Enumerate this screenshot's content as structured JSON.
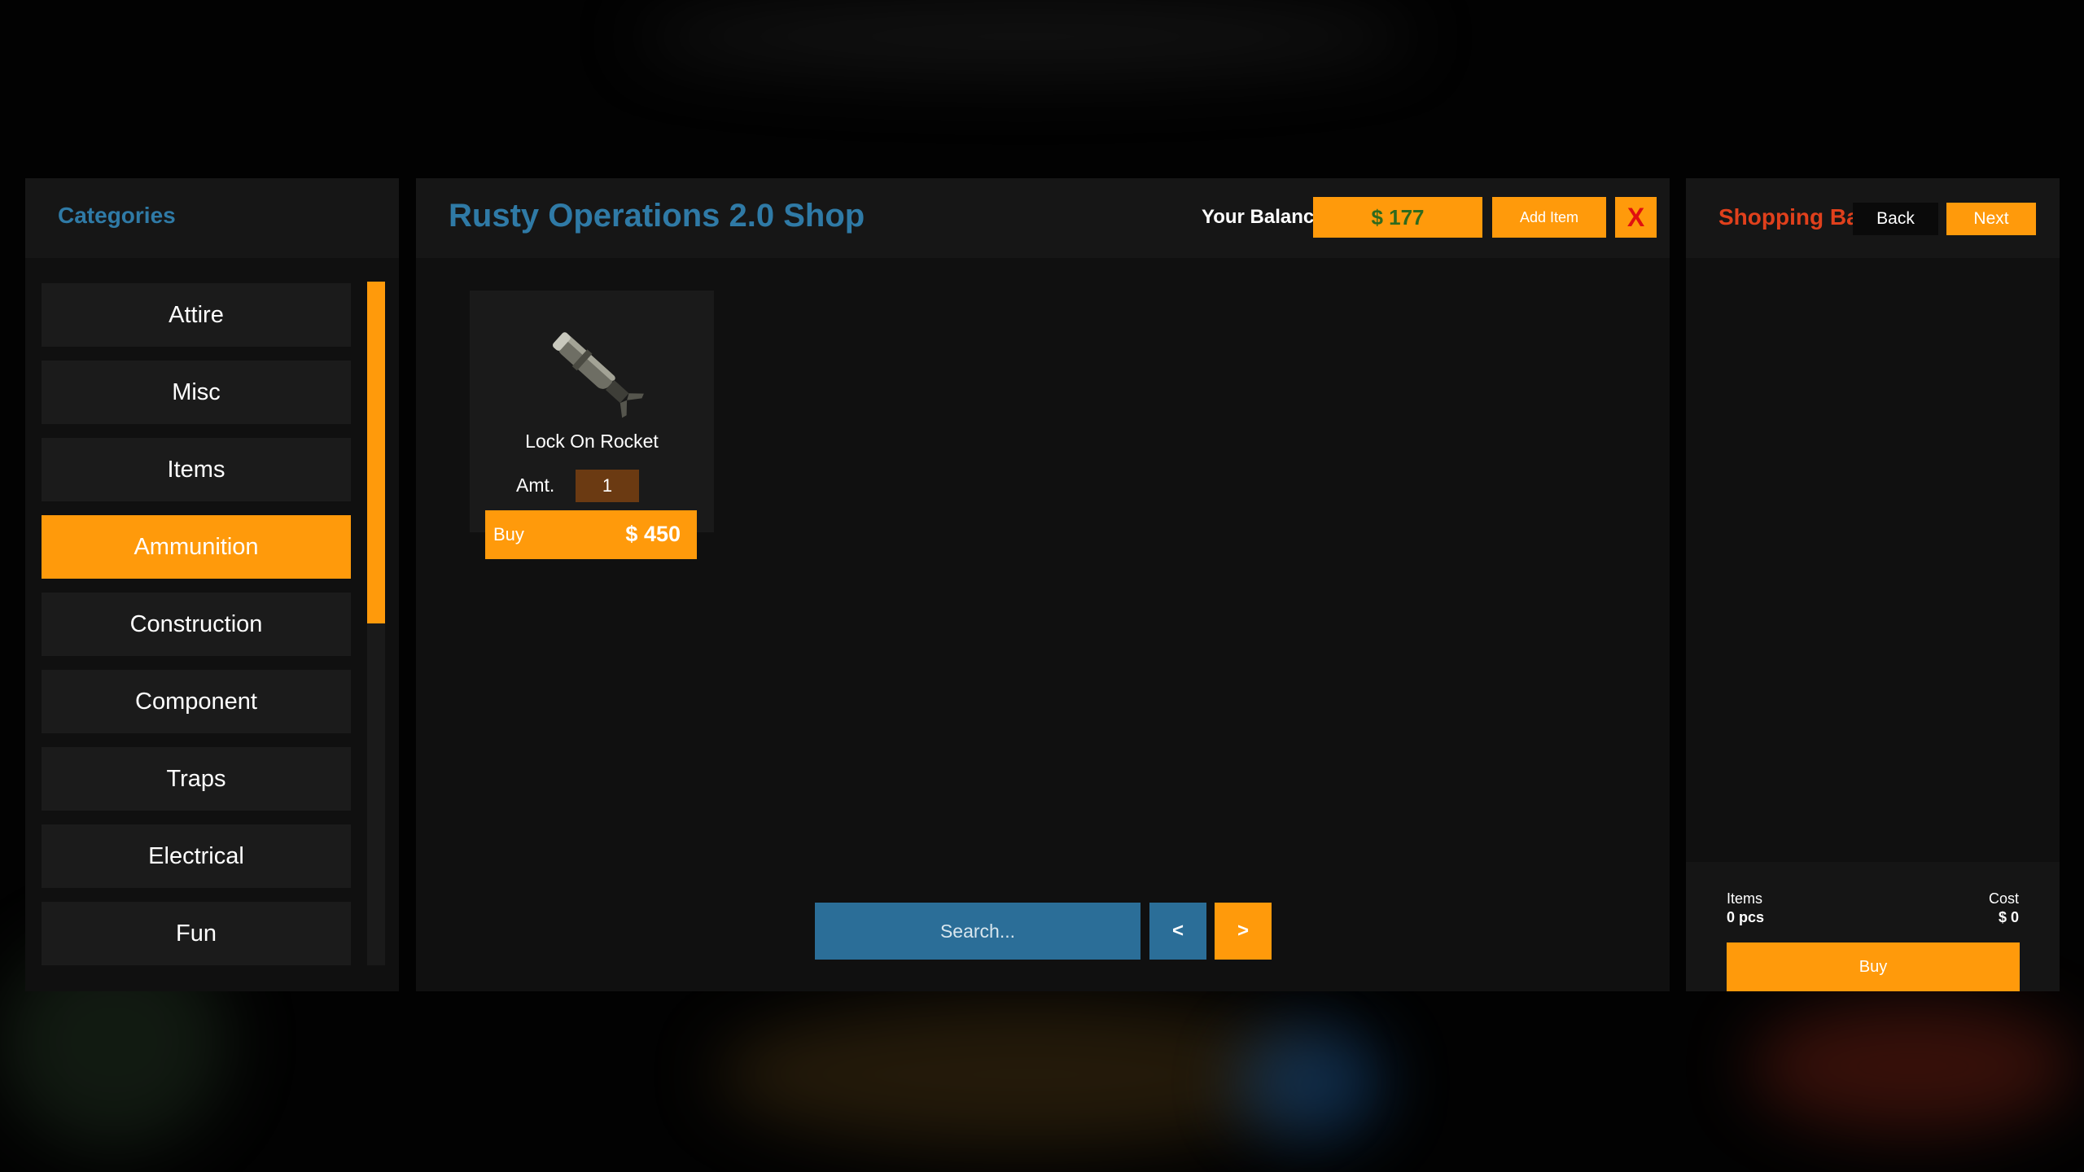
{
  "categories": {
    "title": "Categories",
    "items": [
      {
        "label": "Attire",
        "active": false
      },
      {
        "label": "Misc",
        "active": false
      },
      {
        "label": "Items",
        "active": false
      },
      {
        "label": "Ammunition",
        "active": true
      },
      {
        "label": "Construction",
        "active": false
      },
      {
        "label": "Component",
        "active": false
      },
      {
        "label": "Traps",
        "active": false
      },
      {
        "label": "Electrical",
        "active": false
      },
      {
        "label": "Fun",
        "active": false
      }
    ]
  },
  "shop": {
    "title": "Rusty Operations 2.0 Shop",
    "balance_label": "Your Balance",
    "balance_value": "$ 177",
    "add_item_label": "Add Item",
    "close_label": "X",
    "items": [
      {
        "name": "Lock On Rocket",
        "amount_label": "Amt.",
        "amount": "1",
        "buy_label": "Buy",
        "price": "$ 450",
        "icon": "rocket-icon"
      }
    ],
    "search_placeholder": "Search...",
    "prev_label": "<",
    "next_label": ">"
  },
  "bag": {
    "title": "Shopping Bag",
    "back_label": "Back",
    "next_label": "Next",
    "items_label": "Items",
    "items_value": "0 pcs",
    "cost_label": "Cost",
    "cost_value": "$ 0",
    "buy_label": "Buy"
  },
  "colors": {
    "accent": "#ff9a0b",
    "title_blue": "#2f7aa6",
    "bag_title_red": "#e0401c",
    "panel": "#101010"
  }
}
